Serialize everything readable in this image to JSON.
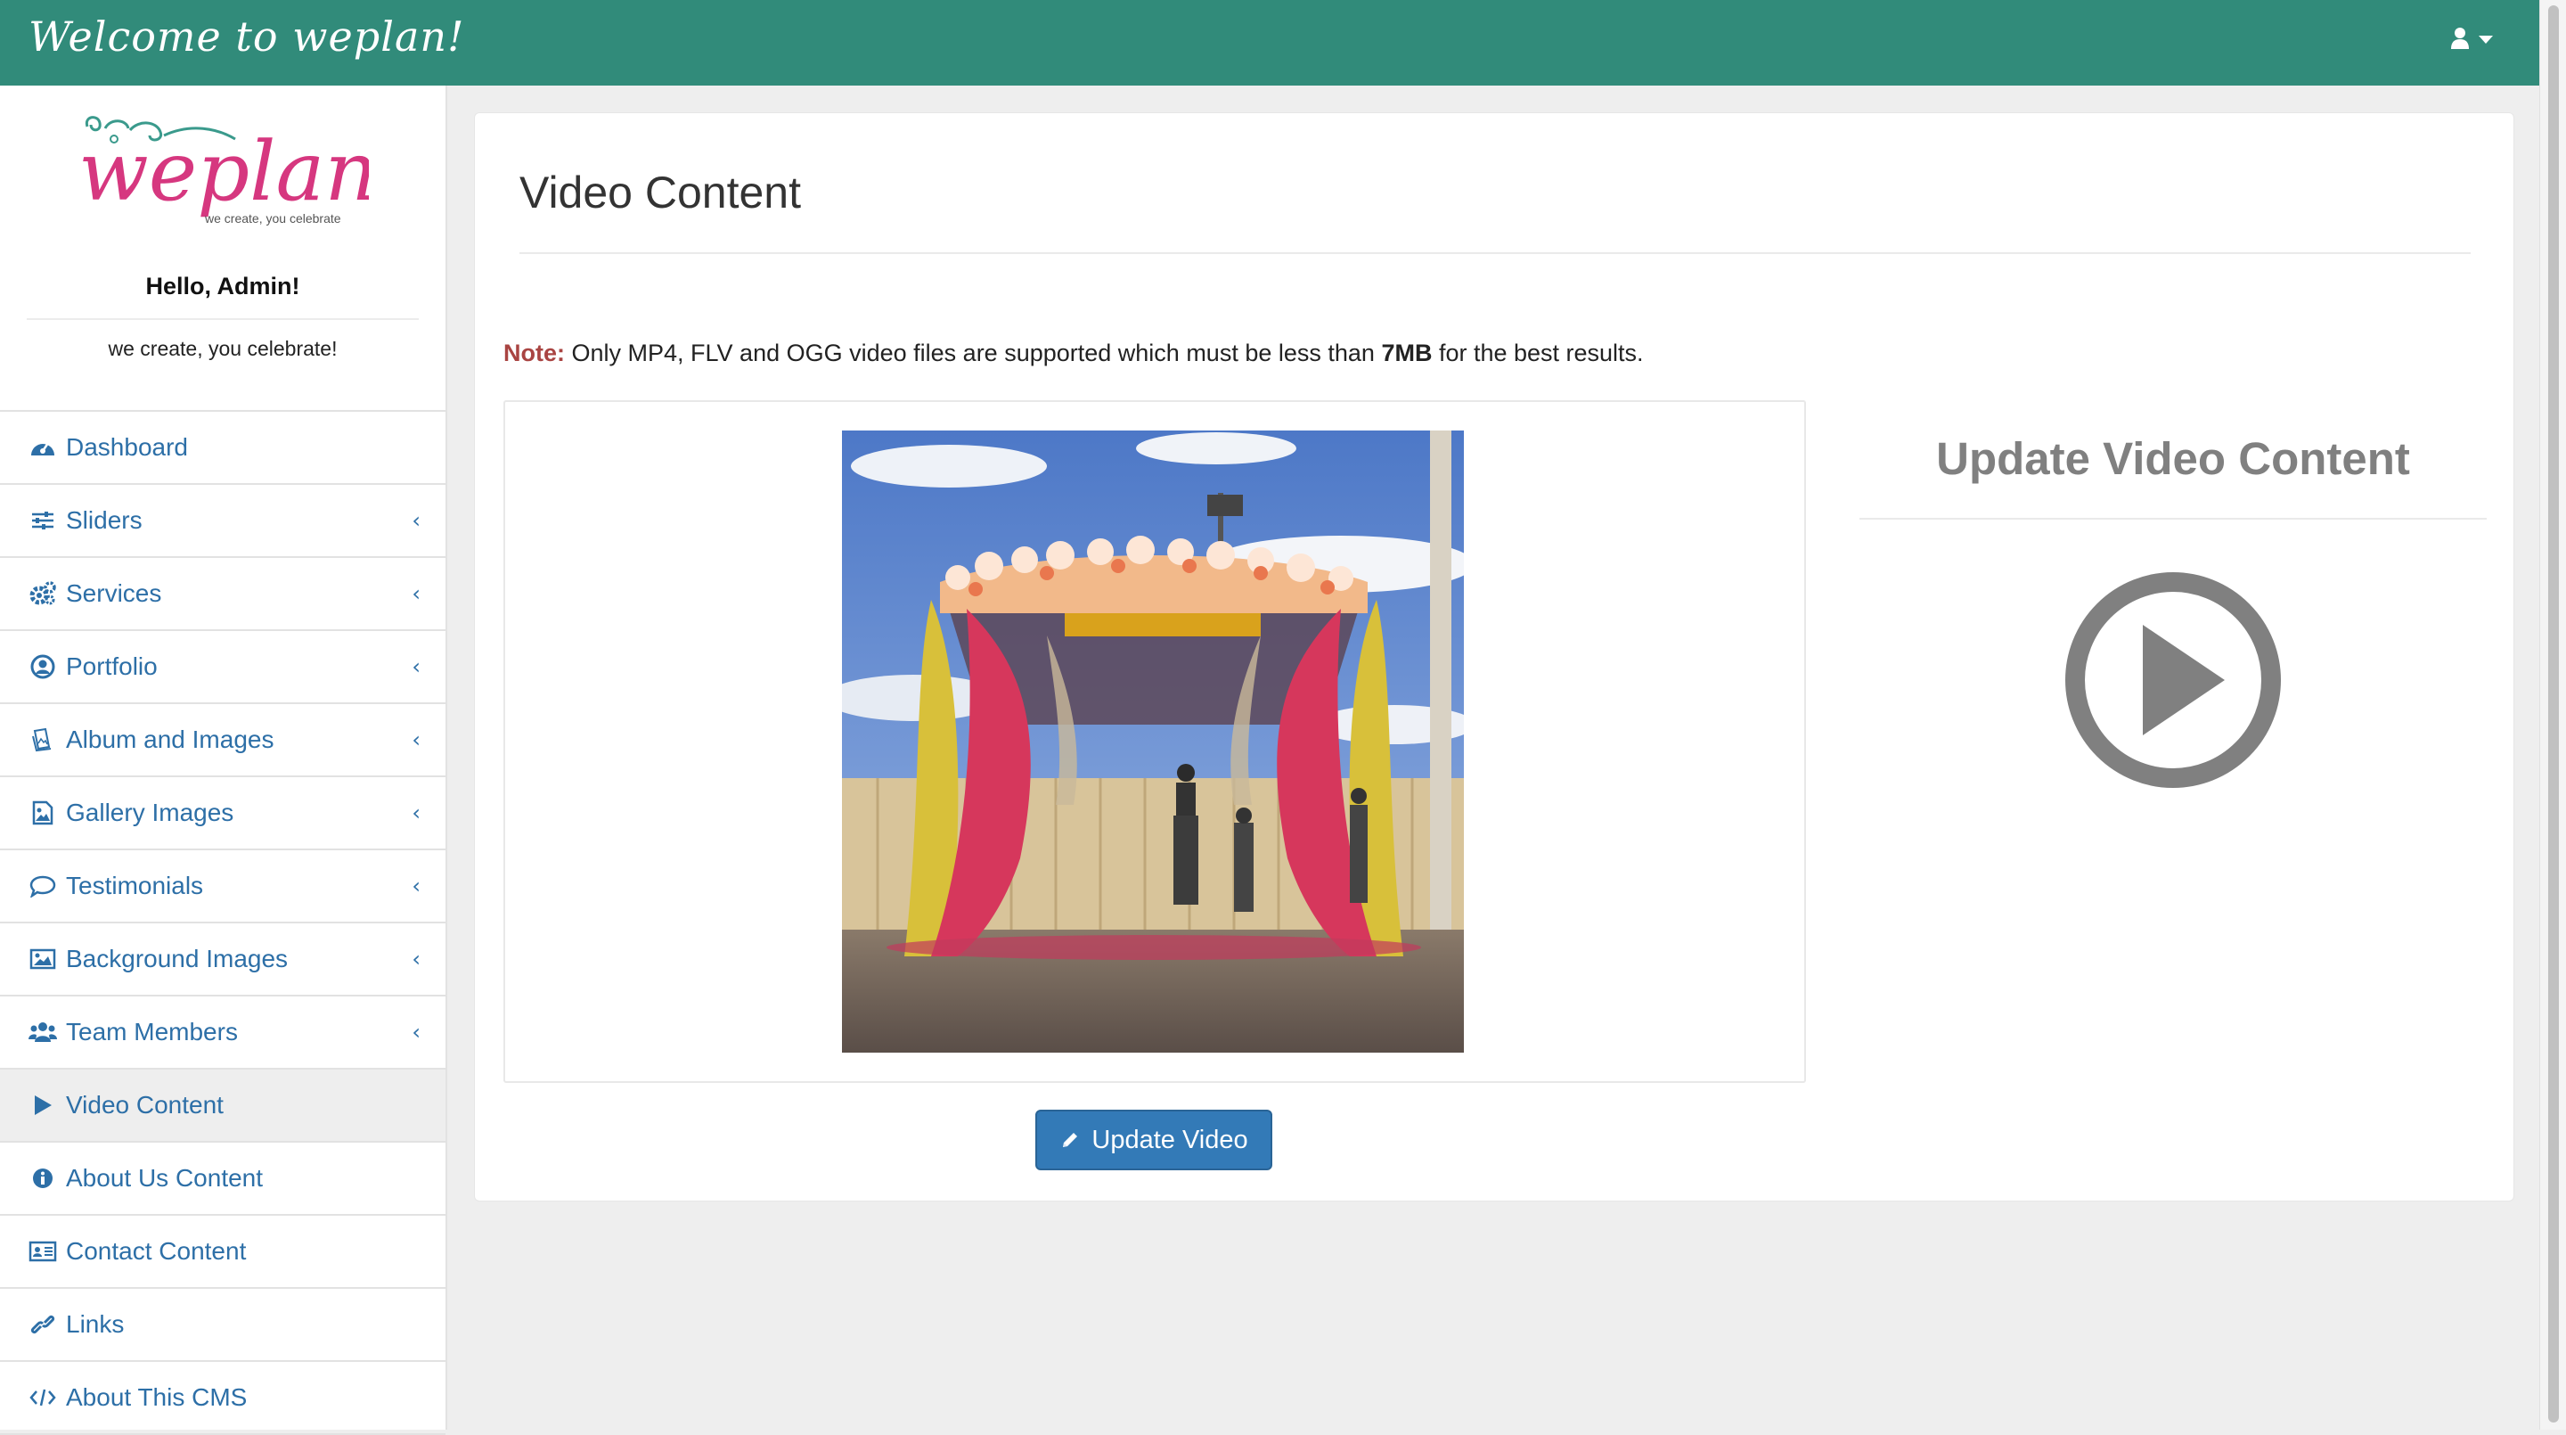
{
  "topbar": {
    "title": "Welcome to weplan!",
    "user_icon": "user-icon"
  },
  "sidebar": {
    "logo": {
      "text": "weplan",
      "tagline": "we create, you celebrate"
    },
    "greeting": "Hello, Admin!",
    "tagline": "we create, you celebrate!",
    "items": [
      {
        "label": "Dashboard",
        "icon": "dashboard-icon",
        "has_submenu": false,
        "active": false
      },
      {
        "label": "Sliders",
        "icon": "sliders-icon",
        "has_submenu": true,
        "active": false
      },
      {
        "label": "Services",
        "icon": "cogs-icon",
        "has_submenu": true,
        "active": false
      },
      {
        "label": "Portfolio",
        "icon": "user-circle-icon",
        "has_submenu": true,
        "active": false
      },
      {
        "label": "Album and Images",
        "icon": "album-icon",
        "has_submenu": true,
        "active": false
      },
      {
        "label": "Gallery Images",
        "icon": "image-file-icon",
        "has_submenu": true,
        "active": false
      },
      {
        "label": "Testimonials",
        "icon": "comment-icon",
        "has_submenu": true,
        "active": false
      },
      {
        "label": "Background Images",
        "icon": "picture-icon",
        "has_submenu": true,
        "active": false
      },
      {
        "label": "Team Members",
        "icon": "users-icon",
        "has_submenu": true,
        "active": false
      },
      {
        "label": "Video Content",
        "icon": "play-icon",
        "has_submenu": false,
        "active": true
      },
      {
        "label": "About Us Content",
        "icon": "info-icon",
        "has_submenu": false,
        "active": false
      },
      {
        "label": "Contact Content",
        "icon": "id-card-icon",
        "has_submenu": false,
        "active": false
      },
      {
        "label": "Links",
        "icon": "link-icon",
        "has_submenu": false,
        "active": false
      },
      {
        "label": "About This CMS",
        "icon": "code-icon",
        "has_submenu": false,
        "active": false
      }
    ]
  },
  "main": {
    "title": "Video Content",
    "note": {
      "label": "Note:",
      "text_before": " Only MP4, FLV and OGG video files are supported which must be less than ",
      "size": "7MB",
      "text_after": " for the best results."
    },
    "update_button": "Update Video",
    "update_heading": "Update Video Content"
  },
  "colors": {
    "topbar": "#318b7a",
    "link": "#2d6fa7",
    "button": "#337ab7",
    "note_label": "#a94442"
  }
}
